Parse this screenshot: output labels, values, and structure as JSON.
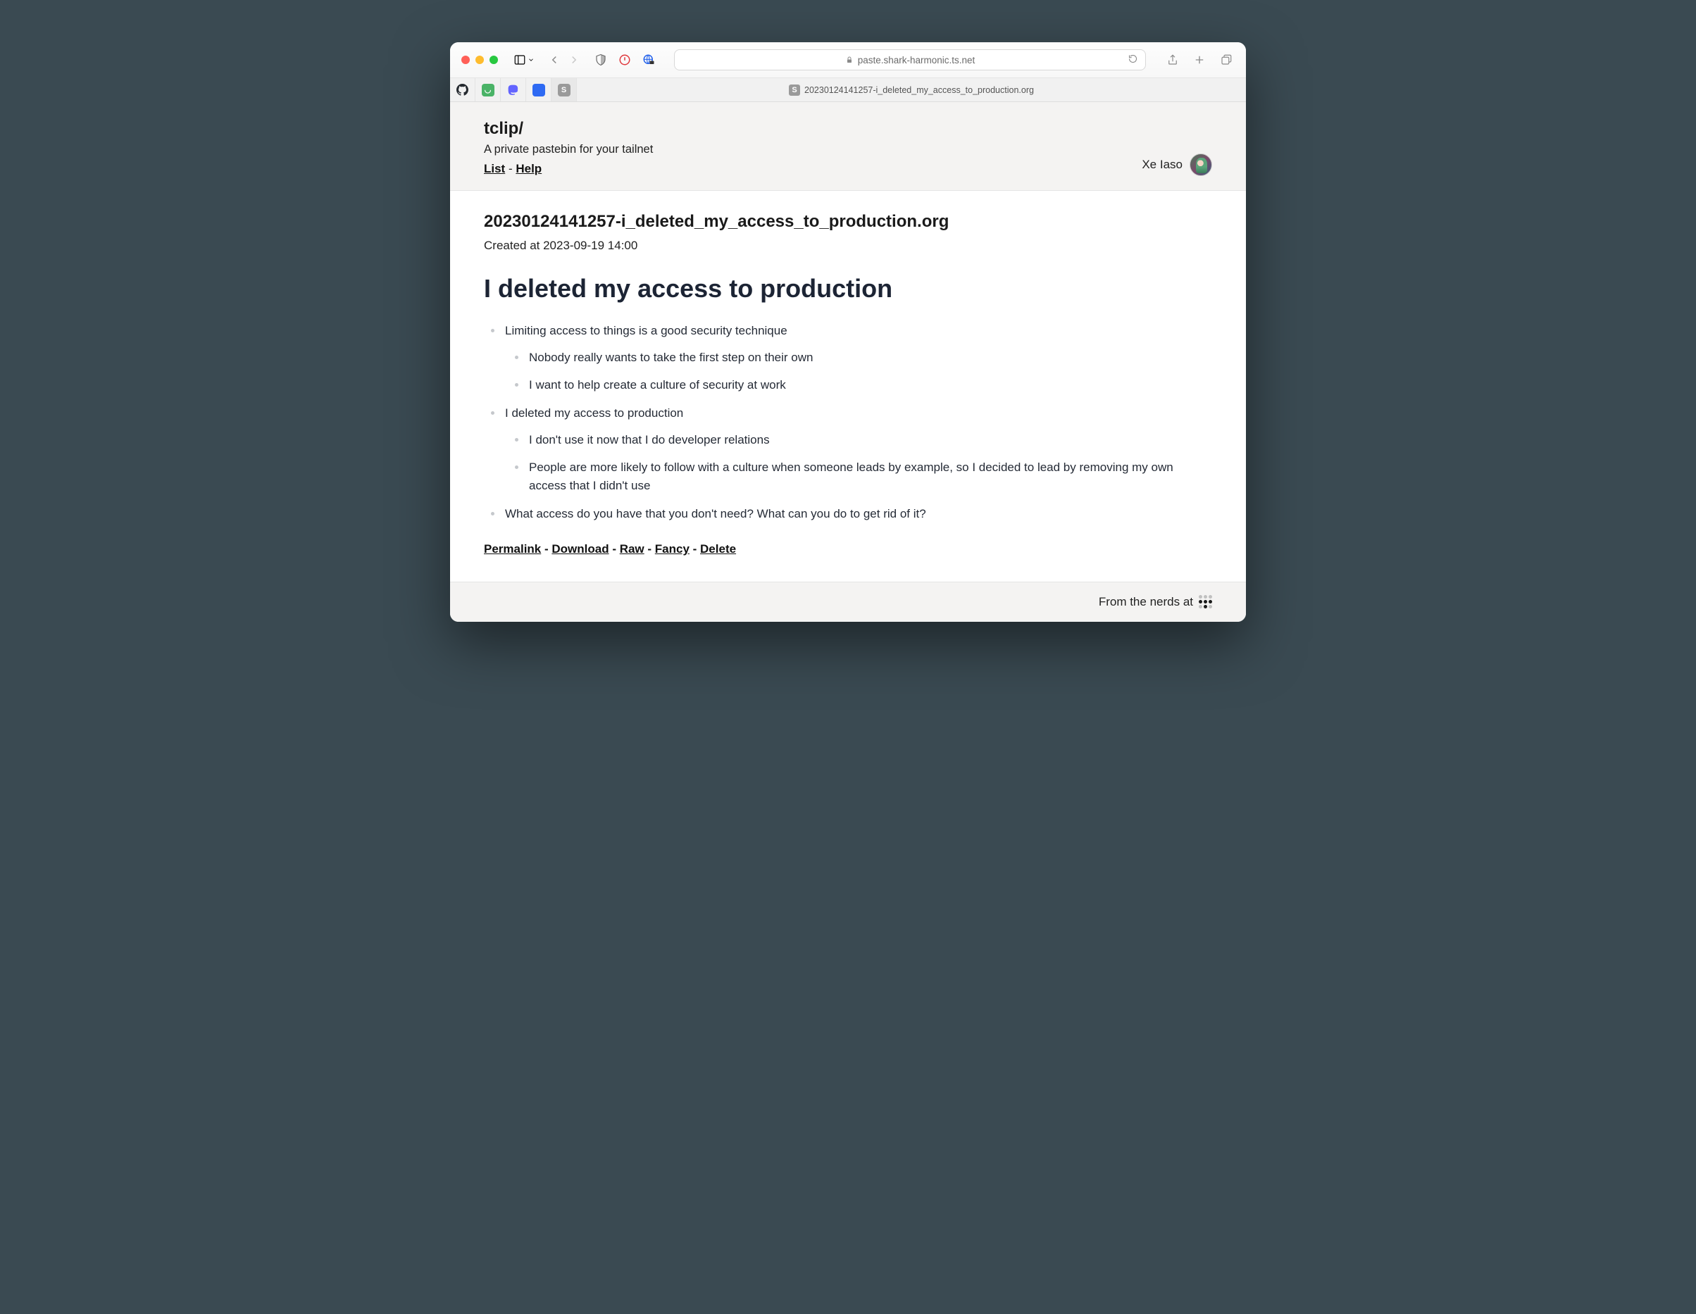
{
  "browser": {
    "url": "paste.shark-harmonic.ts.net",
    "tab_title": "20230124141257-i_deleted_my_access_to_production.org"
  },
  "app": {
    "brand": "tclip/",
    "tagline": "A private pastebin for your tailnet",
    "nav": {
      "list": "List",
      "help": "Help",
      "sep": " - "
    },
    "user": {
      "name": "Xe Iaso"
    }
  },
  "paste": {
    "filename": "20230124141257-i_deleted_my_access_to_production.org",
    "created_label": "Created at 2023-09-19 14:00",
    "heading": "I deleted my access to production",
    "bullets": [
      {
        "text": "Limiting access to things is a good security technique",
        "children": [
          "Nobody really wants to take the first step on their own",
          "I want to help create a culture of security at work"
        ]
      },
      {
        "text": "I deleted my access to production",
        "children": [
          "I don't use it now that I do developer relations",
          "People are more likely to follow with a culture when someone leads by example, so I decided to lead by removing my own access that I didn't use"
        ]
      },
      {
        "text": "What access do you have that you don't need? What can you do to get rid of it?",
        "children": []
      }
    ],
    "actions": {
      "permalink": "Permalink",
      "download": "Download",
      "raw": "Raw",
      "fancy": "Fancy",
      "delete": "Delete",
      "sep": " - "
    }
  },
  "footer": {
    "text": "From the nerds at"
  }
}
